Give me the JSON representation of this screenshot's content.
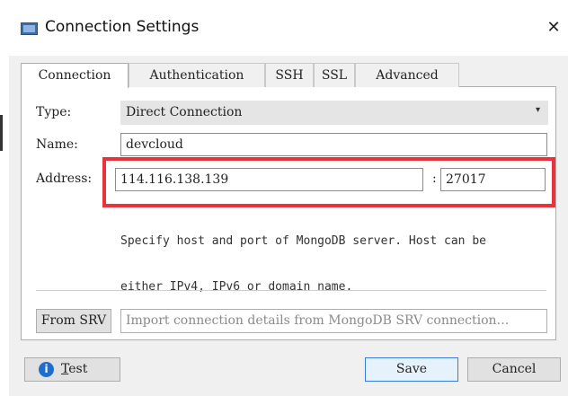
{
  "window": {
    "title": "Connection Settings",
    "close_glyph": "✕",
    "app_icon": "window-icon"
  },
  "tabs": [
    {
      "label": "Connection",
      "active": true
    },
    {
      "label": "Authentication",
      "active": false
    },
    {
      "label": "SSH",
      "active": false
    },
    {
      "label": "SSL",
      "active": false
    },
    {
      "label": "Advanced",
      "active": false
    }
  ],
  "form": {
    "type_label": "Type:",
    "type_value": "Direct Connection",
    "type_arrow": "▾",
    "name_label": "Name:",
    "name_value": "devcloud",
    "address_label": "Address:",
    "host_value": "114.116.138.139",
    "colon": ":",
    "port_value": "27017",
    "hint_line1": "Specify host and port of MongoDB server. Host can be",
    "hint_line2": "either IPv4, IPv6 or domain name."
  },
  "srv": {
    "button_label": "From SRV",
    "placeholder": "Import connection details from MongoDB SRV connection…"
  },
  "footer": {
    "test_first": "T",
    "test_rest": "est",
    "info_glyph": "i",
    "save_label": "Save",
    "cancel_label": "Cancel"
  },
  "colors": {
    "highlight": "#e8323c",
    "info": "#1a6fd0"
  }
}
